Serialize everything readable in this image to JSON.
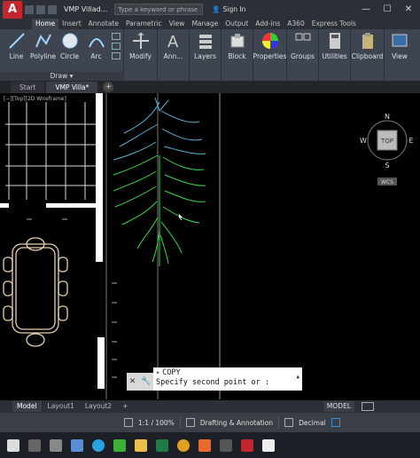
{
  "titlebar": {
    "logo": "A",
    "doc_title": "VMP Villad...",
    "search_placeholder": "Type a keyword or phrase",
    "signin_label": "Sign In",
    "minimize": "—",
    "maximize": "☐",
    "close": "✕"
  },
  "ribbon_tabs": [
    "Home",
    "Insert",
    "Annotate",
    "Parametric",
    "View",
    "Manage",
    "Output",
    "Add-ins",
    "A360",
    "Express Tools"
  ],
  "ribbon": {
    "draw_tools": [
      "Line",
      "Polyline",
      "Circle",
      "Arc"
    ],
    "draw_group_label": "Draw ▾",
    "modify": "Modify",
    "annotation": "Ann...",
    "layers": "Layers",
    "block": "Block",
    "properties": "Properties",
    "groups": "Groups",
    "utilities": "Utilities",
    "clipboard": "Clipboard",
    "view": "View"
  },
  "file_tabs": {
    "start": "Start",
    "active": "VMP Villa*",
    "add": "+"
  },
  "viewport_label": "[−][Top][2D Wireframe]",
  "viewcube": {
    "top": "TOP",
    "north": "N",
    "south": "S",
    "east": "E",
    "west": "W",
    "wcs": "WCS"
  },
  "command_line": {
    "history": "COPY",
    "prompt": "Specify second point or :",
    "close": "✕",
    "settings": "🔧"
  },
  "layout_tabs": {
    "model": "Model",
    "layout1": "Layout1",
    "layout2": "Layout2",
    "add": "+",
    "model_button": "MODEL"
  },
  "statusbar": {
    "scale": "1:1 / 100%",
    "workspace": "Drafting & Annotation",
    "units": "Decimal"
  },
  "colors": {
    "accent_red": "#c1272d",
    "plant_green": "#3ad64a",
    "plant_cyan": "#58b4d6"
  }
}
